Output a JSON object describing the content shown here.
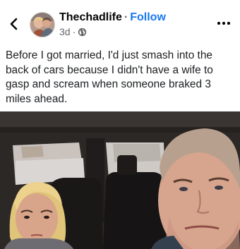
{
  "post": {
    "author": "Thechadlife",
    "separator": "·",
    "follow_label": "Follow",
    "time": "3d",
    "meta_dot": "·",
    "audience_icon": "globe-icon",
    "caption": "Before I got married, I'd just smash into the back of cars because I didn't have a wife to gasp and scream when someone braked 3 miles ahead."
  },
  "icons": {
    "back": "chevron-left-icon",
    "more": "more-horizontal-icon"
  },
  "colors": {
    "follow": "#1877f2",
    "text": "#050505",
    "meta": "#65676b"
  }
}
